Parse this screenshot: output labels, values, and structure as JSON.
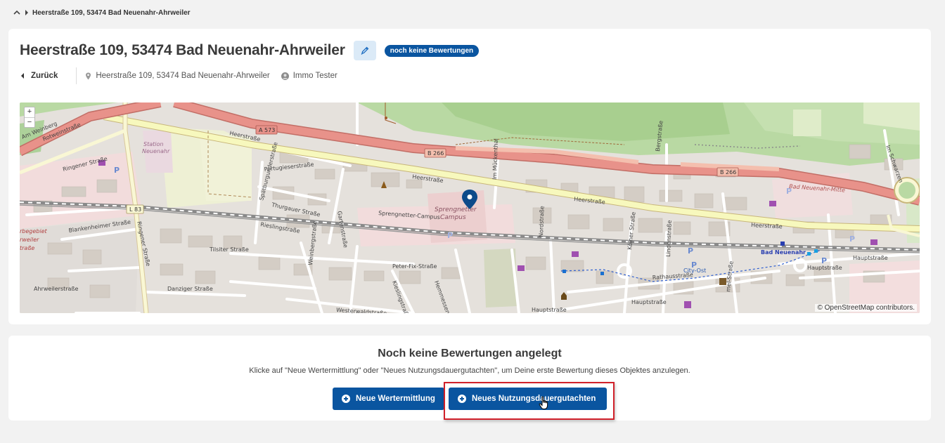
{
  "breadcrumb": {
    "current": "Heerstraße 109, 53474 Bad Neuenahr-Ahrweiler"
  },
  "header": {
    "title": "Heerstraße 109, 53474 Bad Neuenahr-Ahrweiler",
    "status_badge": "noch keine Bewertungen",
    "edit_icon": "pen-icon"
  },
  "meta": {
    "back_label": "Zurück",
    "address": "Heerstraße 109, 53474 Bad Neuenahr-Ahrweiler",
    "user": "Immo Tester",
    "address_icon": "location-pin-icon",
    "user_icon": "user-icon"
  },
  "map": {
    "zoom_in": "+",
    "zoom_out": "−",
    "attribution": "© OpenStreetMap contributors.",
    "labels": {
      "heerstrasse_1": "Heerstraße",
      "heerstrasse_2": "Heerstraße",
      "heerstrasse_3": "Heerstraße",
      "heerstrasse_4": "Heerstraße",
      "a573": "A 573",
      "b266_1": "B 266",
      "b266_2": "B 266",
      "l83": "L 83",
      "rotweinstrasse": "Rotweinstraße",
      "am_weinberg": "Am Weinberg",
      "ringener_strasse_1": "Ringener Straße",
      "ringener_strasse_2": "Ringener Straße",
      "station_neuenahr_1": "Station",
      "station_neuenahr_2": "Neuenahr",
      "portugieserstrasse": "Portugieserstraße",
      "spaetburgunderstrasse": "Spätburgunderstraße",
      "thurgauer_strasse": "Thurgauer Straße",
      "rieslingstrasse": "Rieslingstraße",
      "gartenstrasse": "Gartenstraße",
      "sprengnetter_campus_street": "Sprengnetter-Campus",
      "sprengnetter_campus_1": "Sprengnetter",
      "sprengnetter_campus_2": "Campus",
      "im_muehlenthal": "Im Mückenthal",
      "nordstrasse": "Nordstraße",
      "koelner_strasse": "Kölner Straße",
      "bergstrasse": "Bergstraße",
      "im_schwarzen": "Im Schwarzen",
      "bad_neuenahr_mitte": "Bad Neuenahr-Mitte",
      "bad_neuenahr": "Bad Neuenahr",
      "hauptstrasse_1": "Hauptstraße",
      "hauptstrasse_2": "Hauptstraße",
      "hauptstrasse_3": "Hauptstraße",
      "hauptstrasse_4": "Hauptstraße",
      "rathausstrasse": "Rathausstraße",
      "city_ost": "City-Ost",
      "peter_fix_strasse": "Peter-Fix-Straße",
      "tilsiter_strasse": "Tilsiter Straße",
      "danziger_strasse": "Danziger Straße",
      "ahrweilerstrasse": "Ahrweilerstraße",
      "westerwaldstrasse": "Westerwaldstraße",
      "blankenheimer_strasse": "Blankenheimer Straße",
      "kieslingstrasse": "Kieslingstraße",
      "weinbergstrasse": "Weinbergstraße",
      "gewerbegebiet_1": "rbegebiet",
      "gewerbegebiet_2": "rweiler",
      "gewerbegebiet_3": "traße",
      "mel_strasse": "mel-Straße",
      "lindenstrasse": "Lindenstraße",
      "hemmessener": "Hemmessener",
      "parking": "P"
    }
  },
  "empty_state": {
    "title": "Noch keine Bewertungen angelegt",
    "text": "Klicke auf \"Neue Wertermittlung\" oder \"Neues Nutzungsdauergutachten\", um Deine erste Bewertung dieses Objektes anzulegen.",
    "button_wertermittlung": "Neue Wertermittlung",
    "button_nutzungsdauer": "Neues Nutzungsdauergutachten"
  },
  "colors": {
    "primary": "#0a55a0",
    "highlight": "#d0202a",
    "motorway": "#e8928a",
    "primary_road": "#f7f8bd"
  }
}
